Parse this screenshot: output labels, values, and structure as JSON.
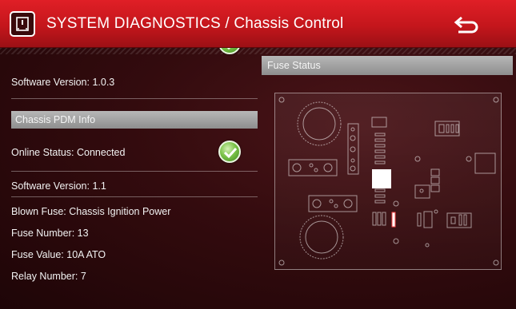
{
  "header": {
    "title": "SYSTEM DIAGNOSTICS / Chassis Control"
  },
  "left_panel": {
    "first_software_version": "Software Version: 1.0.3",
    "section_title": "Chassis PDM Info",
    "online_status": "Online Status: Connected",
    "software_version": "Software Version: 1.1",
    "blown_fuse": "Blown Fuse: Chassis Ignition Power",
    "fuse_number": "Fuse Number: 13",
    "fuse_value": "Fuse Value: 10A ATO",
    "relay_number": "Relay Number: 7"
  },
  "right_panel": {
    "title": "Fuse Status"
  },
  "colors": {
    "header_red": "#c4161c",
    "background": "#330b0e",
    "section_gray": "#a0a0a0",
    "status_green": "#7cc34a",
    "blown_fuse_highlight": "#ffffff"
  },
  "icons": {
    "home": "home-screen-icon",
    "back": "back-arrow-icon",
    "status": "check-icon"
  }
}
